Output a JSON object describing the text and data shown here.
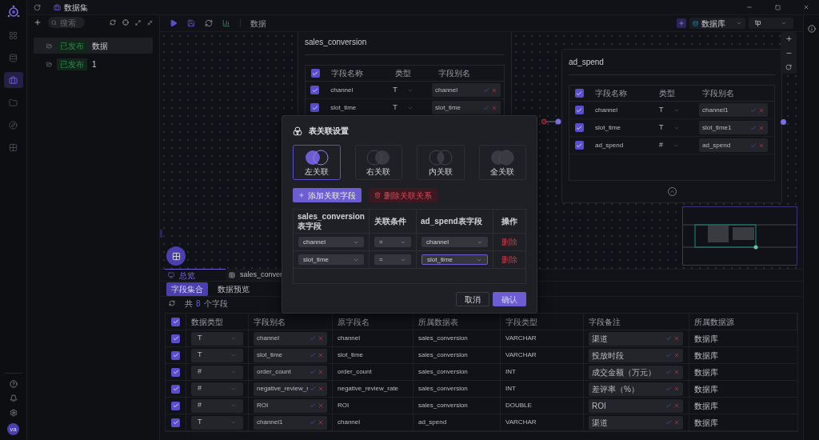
{
  "sidebar": {
    "items": [
      {
        "kind": "apps",
        "selected": false
      },
      {
        "kind": "database",
        "selected": false
      },
      {
        "kind": "dataset",
        "selected": true
      },
      {
        "kind": "folder",
        "selected": false
      },
      {
        "kind": "compass",
        "selected": false
      },
      {
        "kind": "widgets",
        "selected": false
      }
    ],
    "bottom_items": [
      {
        "kind": "help"
      },
      {
        "kind": "bell"
      },
      {
        "kind": "settings"
      }
    ],
    "avatar": "va"
  },
  "titlebar": {
    "title": "数据集"
  },
  "dataset_panel": {
    "search": {
      "placeholder": "搜索"
    },
    "items": [
      {
        "status": "已发布",
        "name": "数据",
        "selected": true
      },
      {
        "status": "已发布",
        "name": "1",
        "selected": false
      }
    ]
  },
  "toolbar": {
    "breadcrumb": "数据",
    "source_select": "数据库",
    "db_select": "tp"
  },
  "canvas": {
    "nodes": [
      {
        "title": "sales_conversion",
        "header_checked": true,
        "columns": [
          "字段名称",
          "类型",
          "字段别名"
        ],
        "rows": [
          {
            "checked": true,
            "name": "channel",
            "type": "T",
            "alias": "channel"
          },
          {
            "checked": true,
            "name": "slot_time",
            "type": "T",
            "alias": "slot_time"
          }
        ]
      },
      {
        "title": "ad_spend",
        "header_checked": true,
        "columns": [
          "字段名称",
          "类型",
          "字段别名"
        ],
        "rows": [
          {
            "checked": true,
            "name": "channel",
            "type": "T",
            "alias": "channel1"
          },
          {
            "checked": true,
            "name": "slot_time",
            "type": "T",
            "alias": "slot_time1"
          },
          {
            "checked": true,
            "name": "ad_spend",
            "type": "#",
            "alias": "ad_spend"
          }
        ]
      }
    ]
  },
  "join_dialog": {
    "title": "表关联设置",
    "join_types": [
      {
        "kind": "left",
        "label": "左关联",
        "selected": true
      },
      {
        "kind": "right",
        "label": "右关联",
        "selected": false
      },
      {
        "kind": "inner",
        "label": "内关联",
        "selected": false
      },
      {
        "kind": "full",
        "label": "全关联",
        "selected": false
      }
    ],
    "add_button": "添加关联字段",
    "delete_button": "删除关联关系",
    "columns": [
      "sales_conversion表字段",
      "关联条件",
      "ad_spend表字段",
      "操作"
    ],
    "rows": [
      {
        "left": "channel",
        "condition": "=",
        "right": "channel",
        "right_focused": false,
        "action": "删除"
      },
      {
        "left": "slot_time",
        "condition": "=",
        "right": "slot_time",
        "right_focused": true,
        "action": "删除"
      }
    ],
    "cancel": "取消",
    "confirm": "确认"
  },
  "bottom_panel": {
    "tabs": [
      {
        "kind": "overview",
        "label": "总览",
        "selected": true
      },
      {
        "kind": "table",
        "label": "sales_conver",
        "selected": false
      }
    ],
    "subtabs": [
      {
        "label": "字段集合",
        "selected": true
      },
      {
        "label": "数据预览",
        "selected": false
      }
    ],
    "count_prefix": "共",
    "count": "8",
    "count_suffix": "个字段",
    "table": {
      "header_checked": true,
      "columns": [
        "数据类型",
        "字段别名",
        "原字段名",
        "所属数据表",
        "字段类型",
        "字段备注",
        "所属数据源"
      ],
      "rows": [
        {
          "checked": true,
          "type": "T",
          "alias": "channel",
          "source_field": "channel",
          "table": "sales_conversion",
          "field_type": "VARCHAR",
          "remark": "渠道",
          "datasource": "数据库"
        },
        {
          "checked": true,
          "type": "T",
          "alias": "slot_time",
          "source_field": "slot_time",
          "table": "sales_conversion",
          "field_type": "VARCHAR",
          "remark": "投放时段",
          "datasource": "数据库"
        },
        {
          "checked": true,
          "type": "#",
          "alias": "order_count",
          "source_field": "order_count",
          "table": "sales_conversion",
          "field_type": "INT",
          "remark": "成交金额（万元）",
          "datasource": "数据库"
        },
        {
          "checked": true,
          "type": "#",
          "alias": "negative_review_r",
          "source_field": "negative_review_rate",
          "table": "sales_conversion",
          "field_type": "INT",
          "remark": "差评率（%）",
          "datasource": "数据库"
        },
        {
          "checked": true,
          "type": "#",
          "alias": "ROI",
          "source_field": "ROI",
          "table": "sales_conversion",
          "field_type": "DOUBLE",
          "remark": "ROI",
          "datasource": "数据库"
        },
        {
          "checked": true,
          "type": "T",
          "alias": "channel1",
          "source_field": "channel",
          "table": "ad_spend",
          "field_type": "VARCHAR",
          "remark": "渠道",
          "datasource": "数据库"
        }
      ]
    }
  }
}
